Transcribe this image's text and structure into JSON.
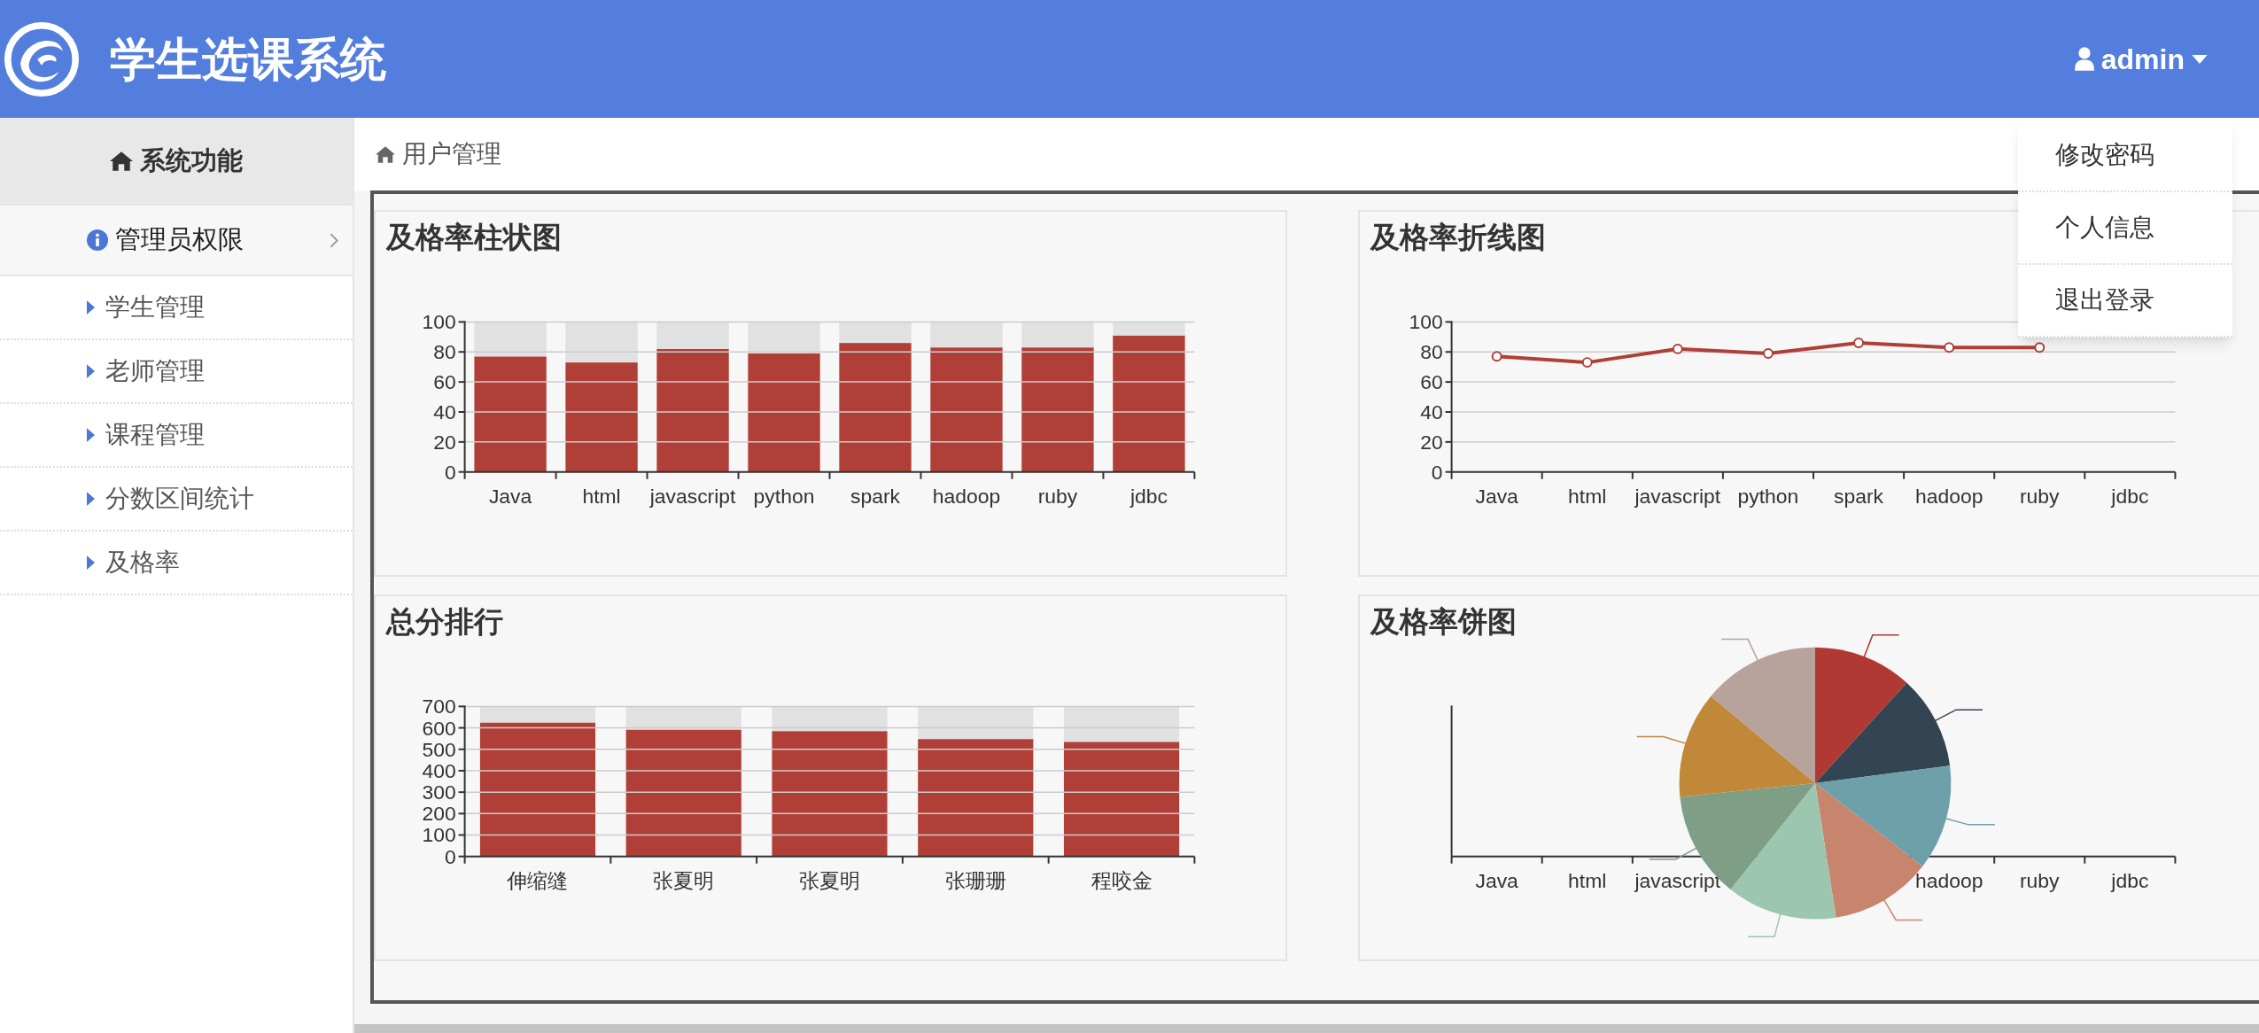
{
  "header": {
    "title": "学生选课系统",
    "user": "admin"
  },
  "user_menu": {
    "expanded": true,
    "items": [
      "修改密码",
      "个人信息",
      "退出登录"
    ]
  },
  "sidebar": {
    "title": "系统功能",
    "group": "管理员权限",
    "items": [
      "学生管理",
      "老师管理",
      "课程管理",
      "分数区间统计",
      "及格率"
    ]
  },
  "breadcrumb": "用户管理",
  "panels": [
    {
      "kind": "chart",
      "title": "及格率柱状图",
      "chart_data": {
        "type": "bar",
        "categories": [
          "Java",
          "html",
          "javascript",
          "python",
          "spark",
          "hadoop",
          "ruby",
          "jdbc"
        ],
        "stacked": true,
        "series": [
          {
            "color": "#b03f38",
            "values": [
              77,
              73,
              82,
              79,
              86,
              83,
              83,
              91
            ]
          },
          {
            "color": "#e1e1e1",
            "values": [
              23,
              27,
              18,
              21,
              14,
              17,
              17,
              9
            ]
          }
        ],
        "ylim": [
          0,
          100
        ],
        "yticks": [
          0,
          20,
          40,
          60,
          80,
          100
        ],
        "grid": true
      }
    },
    {
      "kind": "chart",
      "title": "及格率折线图",
      "chart_data": {
        "type": "line",
        "categories": [
          "Java",
          "html",
          "javascript",
          "python",
          "spark",
          "hadoop",
          "ruby",
          "jdbc"
        ],
        "values": [
          77,
          73,
          82,
          79,
          86,
          83,
          83,
          null
        ],
        "ylim": [
          0,
          100
        ],
        "yticks": [
          0,
          20,
          40,
          60,
          80,
          100
        ],
        "grid": true,
        "marker": true
      }
    },
    {
      "kind": "chart",
      "title": "总分排行",
      "chart_data": {
        "type": "bar",
        "categories": [
          "伸缩缝",
          "张夏明",
          "张夏明",
          "张珊珊",
          "程咬金"
        ],
        "stacked": true,
        "series": [
          {
            "color": "#b03f38",
            "values": [
              625,
              592,
              585,
              548,
              535
            ]
          },
          {
            "color": "#e1e1e1",
            "values": [
              75,
              108,
              115,
              152,
              165
            ]
          }
        ],
        "ylim": [
          0,
          700
        ],
        "yticks": [
          0,
          100,
          200,
          300,
          400,
          500,
          600,
          700
        ],
        "grid": true
      }
    },
    {
      "kind": "pie",
      "title": "及格率饼图",
      "axis_labels_left": [
        "Java",
        "html",
        "javascript"
      ],
      "axis_labels_right": [
        "hadoop",
        "ruby",
        "jdbc"
      ],
      "slices": [
        {
          "color": "#b03a33"
        },
        {
          "color": "#334452"
        },
        {
          "color": "#6ea0aa"
        },
        {
          "color": "#c8856d"
        },
        {
          "color": "#9dc6b0"
        },
        {
          "color": "#7e9e85"
        },
        {
          "color": "#c08838"
        },
        {
          "color": "#b7a39c"
        }
      ]
    }
  ]
}
